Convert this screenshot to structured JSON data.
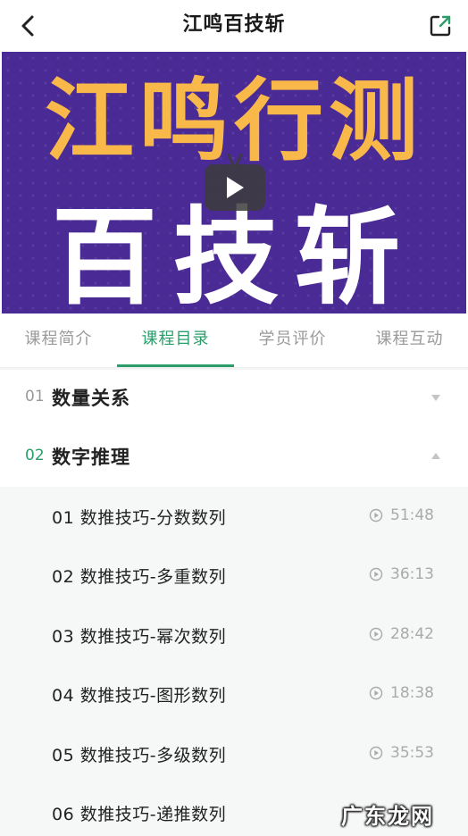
{
  "header": {
    "title": "江鸣百技斩",
    "back_icon": "chevron-left-icon",
    "share_icon": "share-external-icon"
  },
  "banner": {
    "line1": "江鸣行测",
    "line2": "百技斩",
    "play_icon": "play-icon",
    "colors": {
      "background": "#4a2a94",
      "accent": "#f8b84a"
    }
  },
  "tabs": [
    {
      "label": "课程简介",
      "active": false
    },
    {
      "label": "课程目录",
      "active": true
    },
    {
      "label": "学员评价",
      "active": false
    },
    {
      "label": "课程互动",
      "active": false
    }
  ],
  "sections": [
    {
      "num": "01",
      "name": "数量关系",
      "expanded": false
    },
    {
      "num": "02",
      "name": "数字推理",
      "expanded": true
    }
  ],
  "lessons": [
    {
      "title": "01 数推技巧-分数数列",
      "duration": "51:48"
    },
    {
      "title": "02 数推技巧-多重数列",
      "duration": "36:13"
    },
    {
      "title": "03 数推技巧-幂次数列",
      "duration": "28:42"
    },
    {
      "title": "04 数推技巧-图形数列",
      "duration": "18:38"
    },
    {
      "title": "05 数推技巧-多级数列",
      "duration": "35:53"
    },
    {
      "title": "06 数推技巧-递推数列",
      "duration": ""
    }
  ],
  "watermark": "广东龙网",
  "colors": {
    "accent": "#2a9d6a"
  }
}
